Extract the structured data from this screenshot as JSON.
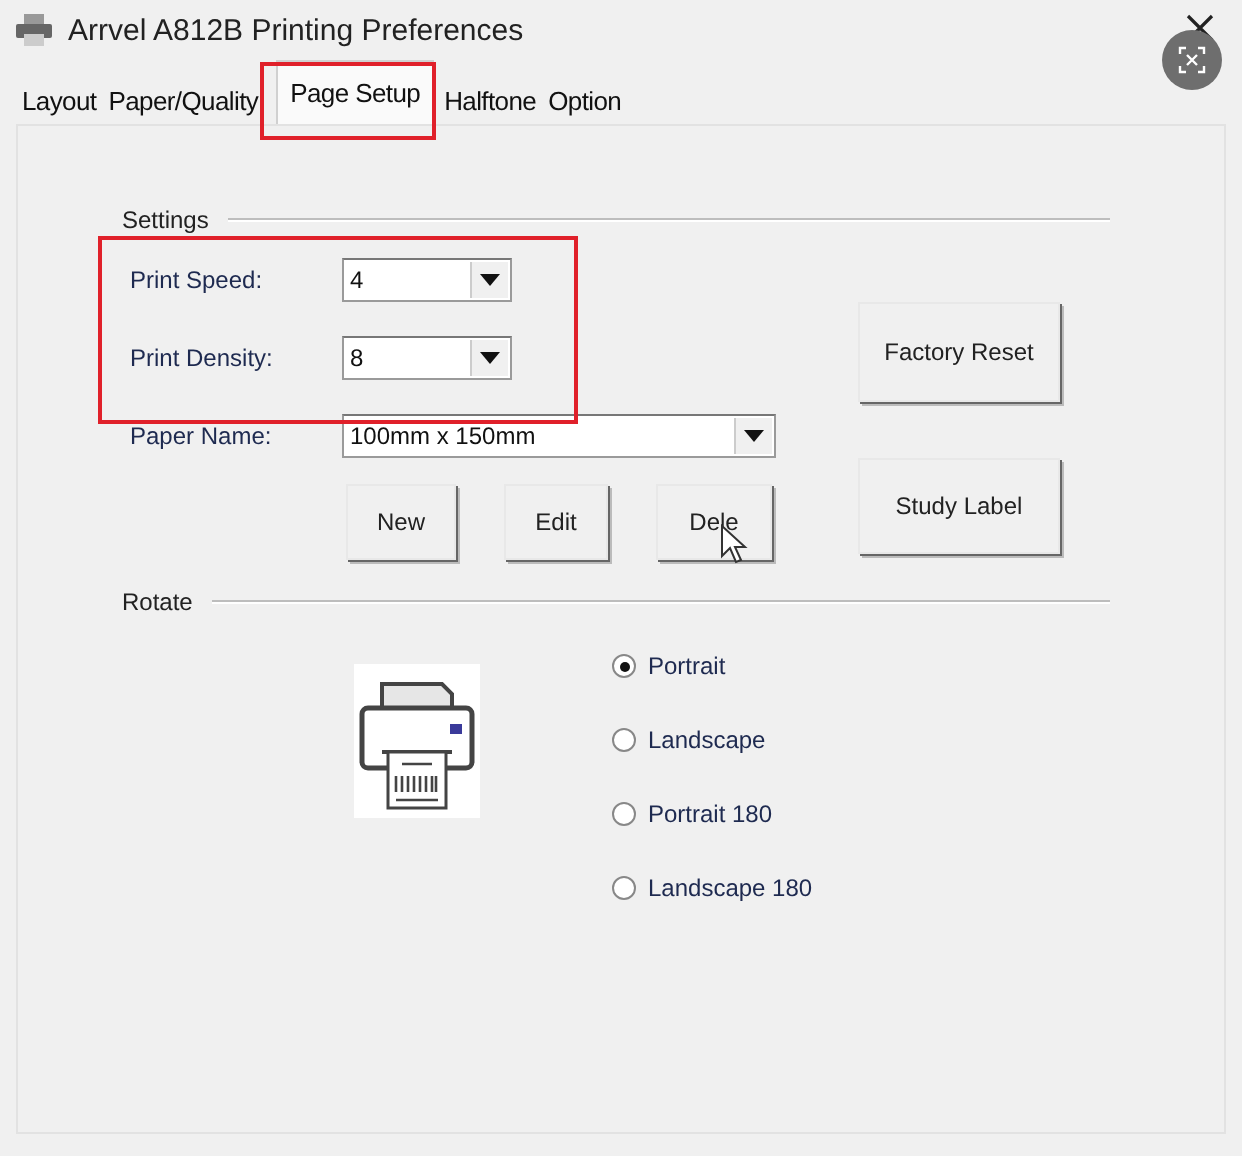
{
  "window": {
    "title": "Arrvel A812B Printing Preferences"
  },
  "tabs": [
    {
      "label": "Layout",
      "selected": false
    },
    {
      "label": "Paper/Quality",
      "selected": false
    },
    {
      "label": "Page Setup",
      "selected": true
    },
    {
      "label": "Halftone",
      "selected": false
    },
    {
      "label": "Option",
      "selected": false
    }
  ],
  "settings": {
    "title": "Settings",
    "highlighted": true,
    "fields": [
      {
        "label": "Print Speed:",
        "value": "4"
      },
      {
        "label": "Print Density:",
        "value": "8"
      },
      {
        "label": "Paper Name:",
        "value": "100mm x 150mm"
      }
    ],
    "paper_buttons": [
      "New",
      "Edit",
      "Dele"
    ],
    "side_buttons": [
      "Factory Reset",
      "Study Label"
    ]
  },
  "rotate": {
    "title": "Rotate",
    "options": [
      {
        "label": "Portrait",
        "selected": true
      },
      {
        "label": "Landscape",
        "selected": false
      },
      {
        "label": "Portrait 180",
        "selected": false
      },
      {
        "label": "Landscape 180",
        "selected": false
      }
    ]
  }
}
